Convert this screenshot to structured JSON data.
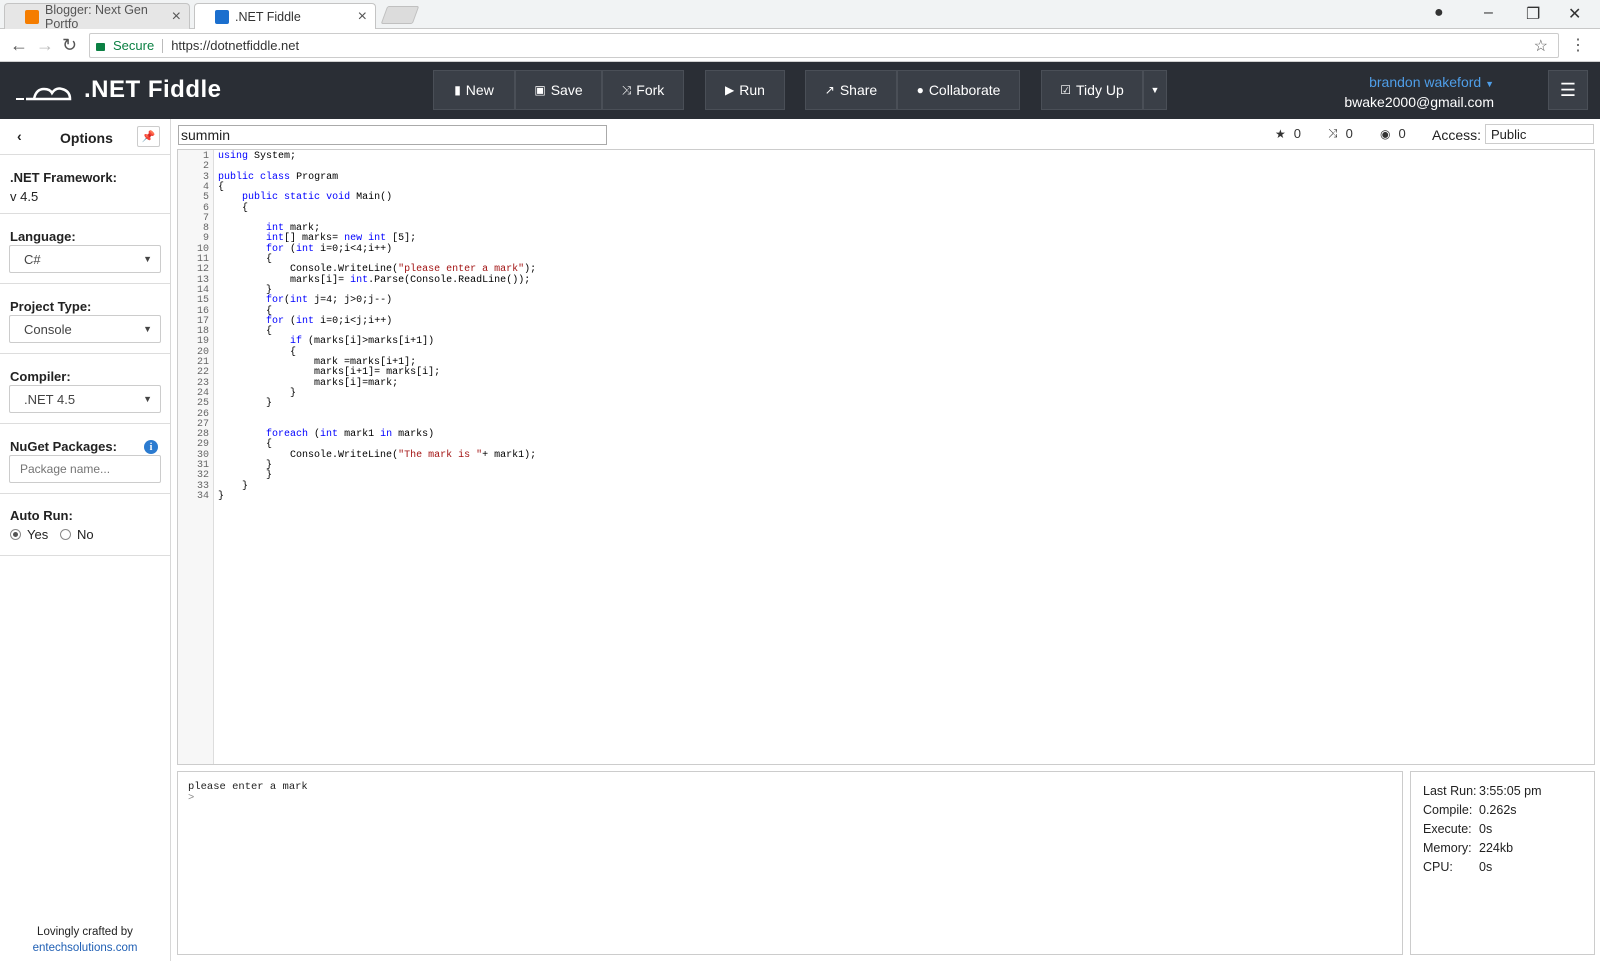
{
  "browser": {
    "tabs": [
      {
        "title": "Blogger: Next Gen Portfo"
      },
      {
        "title": ".NET Fiddle"
      }
    ],
    "secure_label": "Secure",
    "url": "https://dotnetfiddle.net"
  },
  "header": {
    "brand": ".NET Fiddle",
    "buttons": {
      "new": "New",
      "save": "Save",
      "fork": "Fork",
      "run": "Run",
      "share": "Share",
      "collaborate": "Collaborate",
      "tidy": "Tidy Up"
    },
    "user_name": "brandon wakeford",
    "user_email": "bwake2000@gmail.com"
  },
  "sidebar": {
    "title": "Options",
    "framework_label": ".NET Framework:",
    "framework_value": "v 4.5",
    "language_label": "Language:",
    "language_value": "C#",
    "project_label": "Project Type:",
    "project_value": "Console",
    "compiler_label": "Compiler:",
    "compiler_value": ".NET 4.5",
    "nuget_label": "NuGet Packages:",
    "nuget_placeholder": "Package name...",
    "autorun_label": "Auto Run:",
    "autorun_yes": "Yes",
    "autorun_no": "No",
    "autorun_selected": "Yes",
    "credit_line": "Lovingly crafted by",
    "credit_link": "entechsolutions.com"
  },
  "fiddle": {
    "name": "summin",
    "stars": "0",
    "forks": "0",
    "views": "0",
    "access_label": "Access:",
    "access_value": "Public"
  },
  "code_lines": [
    "using System;",
    "",
    "public class Program",
    "{",
    "    public static void Main()",
    "    {",
    "",
    "        int mark;",
    "        int[] marks= new int [5];",
    "        for (int i=0;i<4;i++)",
    "        {",
    "            Console.WriteLine(\"please enter a mark\");",
    "            marks[i]= int.Parse(Console.ReadLine());",
    "        }",
    "        for(int j=4; j>0;j--)",
    "        {",
    "        for (int i=0;i<j;i++)",
    "        {",
    "            if (marks[i]>marks[i+1])",
    "            {",
    "                mark =marks[i+1];",
    "                marks[i+1]= marks[i];",
    "                marks[i]=mark;",
    "            }",
    "        }",
    "",
    "",
    "        foreach (int mark1 in marks)",
    "        {",
    "            Console.WriteLine(\"The mark is \"+ mark1);",
    "        }",
    "        }",
    "    }",
    "}"
  ],
  "output": {
    "line1": "please enter a mark",
    "prompt": ">"
  },
  "run_info": {
    "last_run_label": "Last Run:",
    "last_run": "3:55:05 pm",
    "compile_label": "Compile:",
    "compile": "0.262s",
    "execute_label": "Execute:",
    "execute": "0s",
    "memory_label": "Memory:",
    "memory": "224kb",
    "cpu_label": "CPU:",
    "cpu": "0s"
  },
  "colors": {
    "header_bg": "#2a2e35",
    "keyword": "#0000ff",
    "string": "#a31515",
    "user_link": "#4f9ee8"
  }
}
